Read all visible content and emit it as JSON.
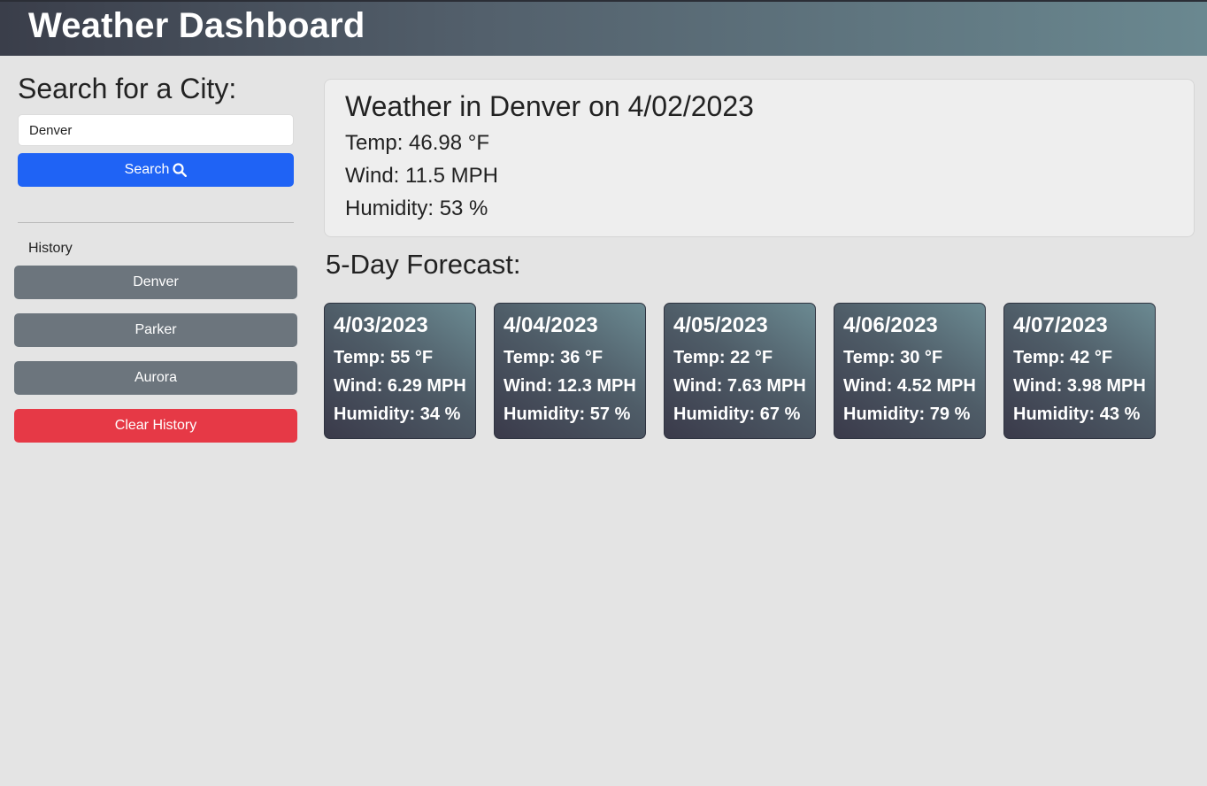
{
  "header": {
    "title": "Weather Dashboard"
  },
  "sidebar": {
    "search_title": "Search for a City:",
    "search_input_value": "Denver",
    "search_button_label": "Search",
    "history_label": "History",
    "history": [
      "Denver",
      "Parker",
      "Aurora"
    ],
    "clear_label": "Clear History"
  },
  "current": {
    "title": "Weather in Denver on 4/02/2023",
    "temp": "Temp: 46.98 °F",
    "wind": "Wind: 11.5 MPH",
    "humidity": "Humidity: 53 %"
  },
  "forecast": {
    "title": "5-Day Forecast:",
    "days": [
      {
        "date": "4/03/2023",
        "temp": "Temp: 55 °F",
        "wind": "Wind: 6.29 MPH",
        "humidity": "Humidity: 34 %"
      },
      {
        "date": "4/04/2023",
        "temp": "Temp: 36 °F",
        "wind": "Wind: 12.3 MPH",
        "humidity": "Humidity: 57 %"
      },
      {
        "date": "4/05/2023",
        "temp": "Temp: 22 °F",
        "wind": "Wind: 7.63 MPH",
        "humidity": "Humidity: 67 %"
      },
      {
        "date": "4/06/2023",
        "temp": "Temp: 30 °F",
        "wind": "Wind: 4.52 MPH",
        "humidity": "Humidity: 79 %"
      },
      {
        "date": "4/07/2023",
        "temp": "Temp: 42 °F",
        "wind": "Wind: 3.98 MPH",
        "humidity": "Humidity: 43 %"
      }
    ]
  },
  "colors": {
    "search_button": "#1f63f5",
    "history_button": "#6c757d",
    "clear_button": "#e63946"
  },
  "icons": {
    "search": "search-icon"
  }
}
